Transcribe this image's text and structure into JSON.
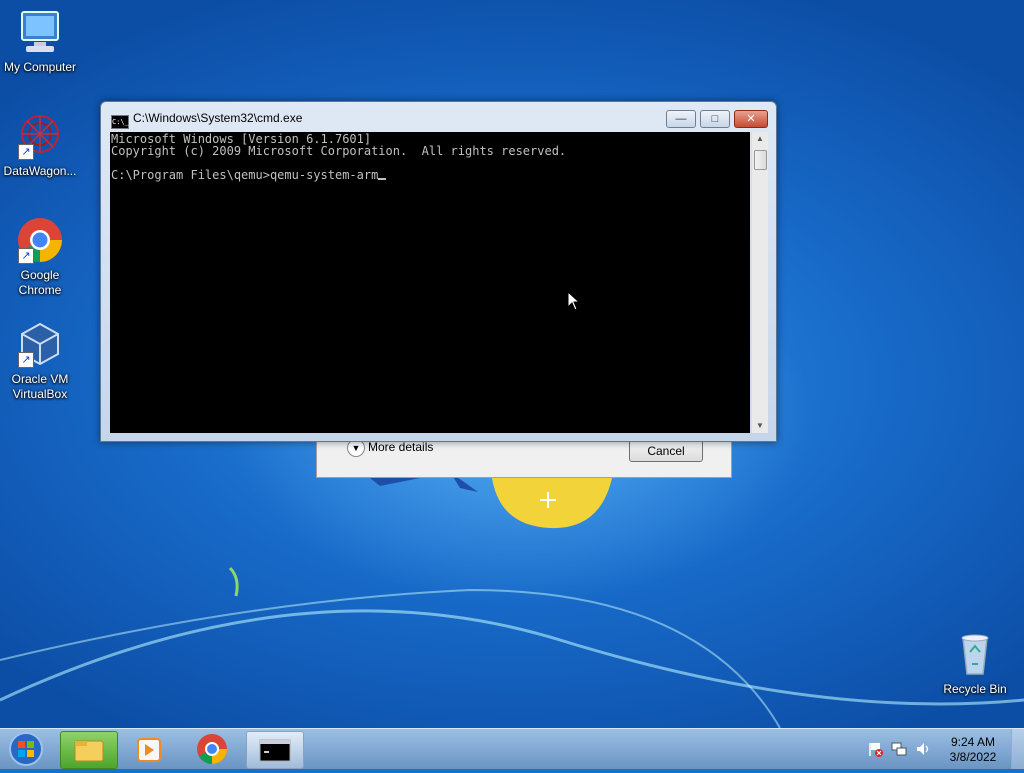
{
  "desktop": {
    "icons": [
      {
        "label": "My Computer"
      },
      {
        "label": "DataWagon..."
      },
      {
        "label": "Google\nChrome"
      },
      {
        "label": "Oracle VM\nVirtualBox"
      },
      {
        "label": "Recycle Bin"
      }
    ]
  },
  "dialog_behind": {
    "more_details": "More details",
    "cancel": "Cancel"
  },
  "cmd_window": {
    "title": "C:\\Windows\\System32\\cmd.exe",
    "icon_text": "C:\\_",
    "minimize": "—",
    "maximize": "□",
    "close": "✕",
    "lines": [
      "Microsoft Windows [Version 6.1.7601]",
      "Copyright (c) 2009 Microsoft Corporation.  All rights reserved.",
      "",
      "C:\\Program Files\\qemu>qemu-system-arm"
    ]
  },
  "taskbar": {
    "items": [
      "start-button",
      "explorer",
      "media-player",
      "chrome",
      "cmd"
    ],
    "clock_time": "9:24 AM",
    "clock_date": "3/8/2022"
  }
}
